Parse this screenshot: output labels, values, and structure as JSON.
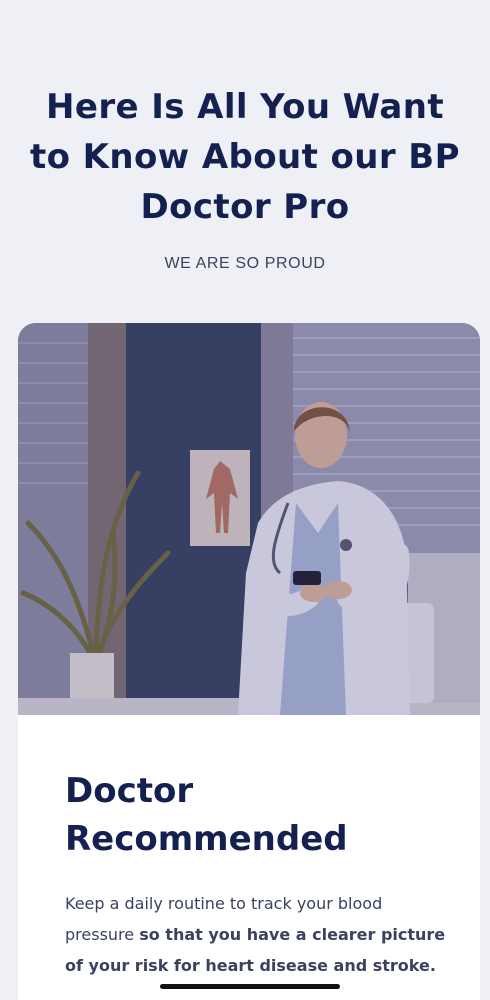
{
  "hero": {
    "title": "Here Is All You Want to Know About our BP Doctor Pro",
    "subtitle": "WE ARE SO PROUD"
  },
  "card": {
    "image_icon": "doctor-photo",
    "title": "Doctor Recommended",
    "body_regular": "Keep a daily routine to track your blood pressure ",
    "body_emphasis": "so that you have a clearer picture of your risk for heart disease and stroke."
  },
  "colors": {
    "background": "#eef0f6",
    "heading": "#142150",
    "body_text": "#3b4260",
    "card": "#ffffff"
  }
}
